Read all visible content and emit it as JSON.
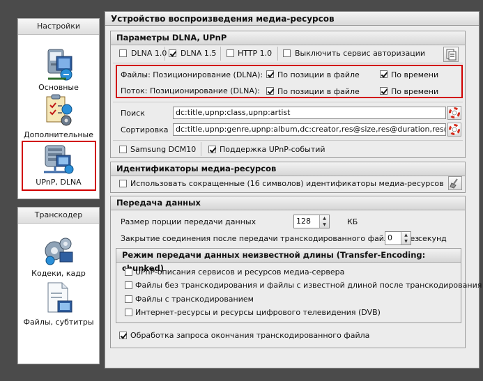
{
  "nav": {
    "settings_header": "Настройки",
    "items": [
      {
        "label": "Основные",
        "icon": "basic-settings-icon"
      },
      {
        "label": "Дополнительные",
        "icon": "advanced-settings-icon"
      },
      {
        "label": "UPnP, DLNA",
        "icon": "upnp-dlna-icon",
        "selected": true
      }
    ],
    "transcoder_header": "Транскодер",
    "transcoder_items": [
      {
        "label": "Кодеки, кадр",
        "icon": "codecs-icon"
      },
      {
        "label": "Файлы, субтитры",
        "icon": "files-subtitles-icon"
      }
    ]
  },
  "main": {
    "title": "Устройство воспроизведения медиа-ресурсов",
    "dlna": {
      "header": "Параметры DLNA, UPnP",
      "dlna10": "DLNA 1.0",
      "dlna15": "DLNA 1.5",
      "http10": "HTTP 1.0",
      "disable_auth": "Выключить сервис авторизации",
      "files_seek": "Файлы: Позиционирование (DLNA):",
      "stream_seek": "Поток: Позиционирование (DLNA):",
      "by_position": "По позиции в файле",
      "by_time": "По времени",
      "search_label": "Поиск",
      "search_value": "dc:title,upnp:class,upnp:artist",
      "sort_label": "Сортировка",
      "sort_value": "dc:title,upnp:genre,upnp:album,dc:creator,res@size,res@duration,res@bitrate,p",
      "samsung": "Samsung DCM10",
      "upnp_events": "Поддержка UPnP-событий"
    },
    "ids": {
      "header": "Идентификаторы медиа-ресурсов",
      "short_ids": "Использовать сокращенные (16 символов) идентификаторы медиа-ресурсов"
    },
    "transfer": {
      "header": "Передача данных",
      "chunk_label": "Размер порции передачи данных",
      "chunk_value": "128",
      "chunk_unit": "КБ",
      "close_label": "Закрытие соединения после передачи транскодированного файла через",
      "close_value": "0",
      "close_unit": "секунд",
      "unknown_header": "Режим передачи данных неизвестной длины (Transfer-Encoding: chunked)",
      "opt1": "UPnP-описания сервисов и ресурсов медиа-сервера",
      "opt2": "Файлы без транскодирования и файлы с известной длиной после транскодирования",
      "opt3": "Файлы с транскодированием",
      "opt4": "Интернет-ресурсы и ресурсы цифрового телевидения (DVB)",
      "end_request": "Обработка запроса окончания транскодированного файла"
    }
  },
  "colors": {
    "highlight": "#d10000",
    "background": "#4b4b4b",
    "panel": "#ececec"
  }
}
